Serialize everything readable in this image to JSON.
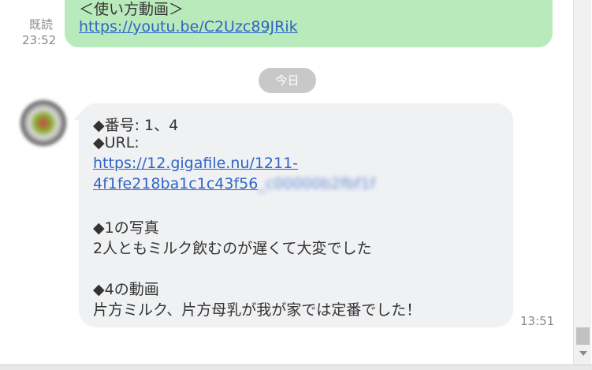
{
  "previous_message": {
    "title_line": "＜使い方動画＞",
    "link": "https://youtu.be/C2Uzc89JRik",
    "read_label": "既読",
    "time": "23:52"
  },
  "date_separator": "今日",
  "received_message": {
    "lines": [
      "◆番号: 1、4",
      "◆URL:",
      "◆1の写真",
      "2人ともミルク飲むのが遅くて大変でした",
      "◆4の動画",
      "片方ミルク、片方母乳が我が家では定番でした！"
    ],
    "link_line1": "https://12.gigafile.nu/1211-",
    "link_line2_visible": "4f1fe218ba1c1c43f56",
    "link_line2_blurred": "_c00000b2fbf1f",
    "time": "13:51"
  },
  "colors": {
    "sent_bubble": "#b9eabb",
    "received_bubble": "#f0f1f3",
    "link": "#2f64c7",
    "date_pill": "#c8c8c8"
  }
}
